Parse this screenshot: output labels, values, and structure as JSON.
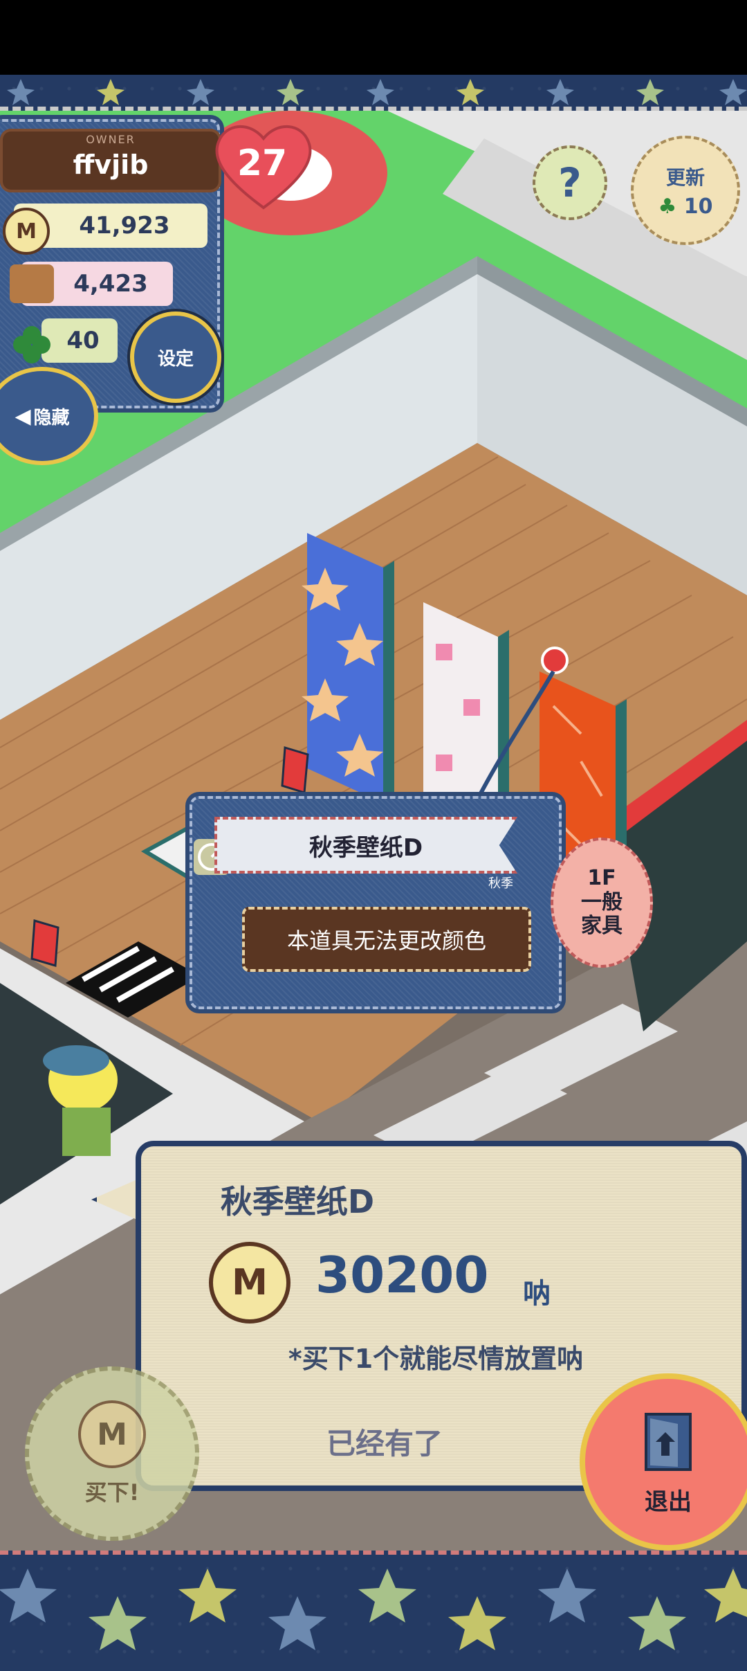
{
  "owner": {
    "caption": "OWNER",
    "name": "ffvjib"
  },
  "level": "27",
  "resources": {
    "coins": "41,923",
    "basket": "4,423",
    "clover": "40"
  },
  "buttons": {
    "settings": "设定",
    "hide": "隐藏",
    "help": "?",
    "update": "更新",
    "update_count": "10",
    "buy": "买下!",
    "exit": "退出"
  },
  "item_popup": {
    "title": "秋季壁纸D",
    "tag": "秋季",
    "note": "本道具无法更改颜色"
  },
  "floor_badge": {
    "floor": "1F",
    "line1": "一般",
    "line2": "家具"
  },
  "purchase": {
    "item_name": "秋季壁纸D",
    "price": "30200",
    "unit": "呐",
    "note": "*买下1个就能尽情放置呐",
    "status": "已经有了"
  },
  "colors": {
    "denim": "#3a5a8c",
    "gold_border": "#e9c548",
    "panel": "#ebe2c6",
    "exit": "#f47a6e"
  }
}
